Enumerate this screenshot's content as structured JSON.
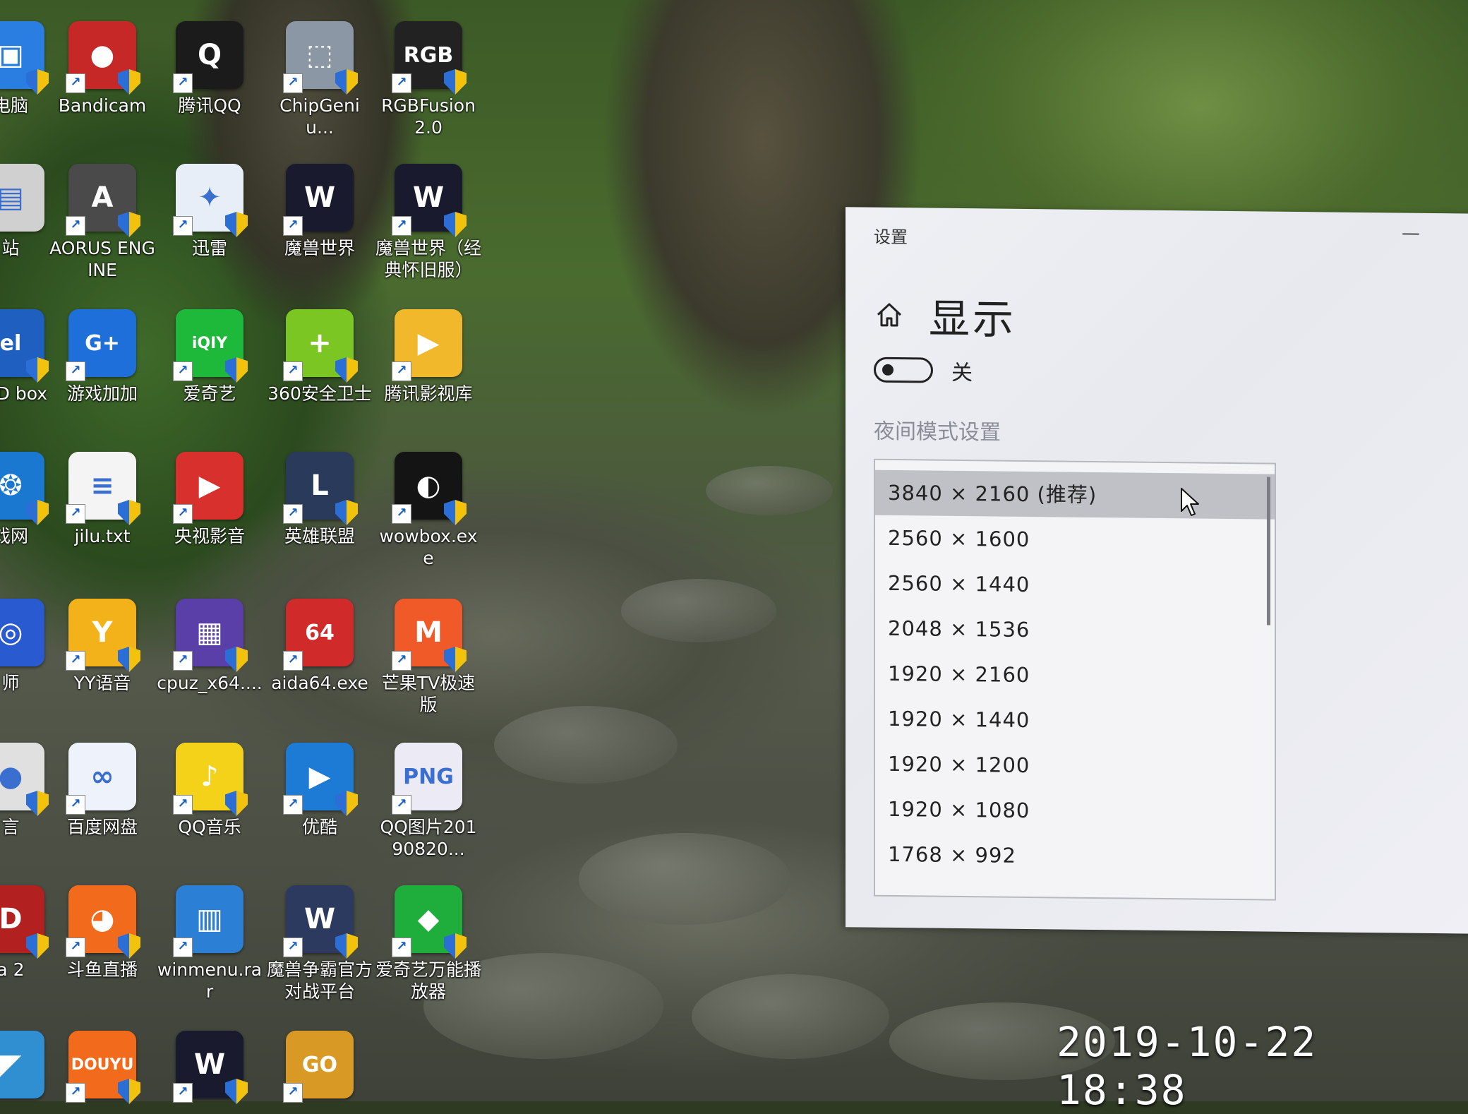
{
  "desktop": {
    "icons": [
      {
        "label": "电脑",
        "color": "#2a7de1",
        "glyph": "▣"
      },
      {
        "label": "Bandicam",
        "color": "#c62828",
        "glyph": "●"
      },
      {
        "label": "腾讯QQ",
        "color": "#1b1b1b",
        "glyph": "Q"
      },
      {
        "label": "ChipGeniu...",
        "color": "#8c97a6",
        "glyph": "⬚"
      },
      {
        "label": "RGBFusion 2.0",
        "color": "#222222",
        "glyph": "RGB"
      },
      {
        "label": "站",
        "color": "#d0d0d0",
        "glyph": "▤"
      },
      {
        "label": "AORUS ENGINE",
        "color": "#4a4a4a",
        "glyph": "A"
      },
      {
        "label": "迅雷",
        "color": "#e8eef8",
        "glyph": "✦"
      },
      {
        "label": "魔兽世界",
        "color": "#1a1a2e",
        "glyph": "W"
      },
      {
        "label": "魔兽世界（经典怀旧服）",
        "color": "#1a1a2e",
        "glyph": "W"
      },
      {
        "label": "SSD box",
        "color": "#1f5fbf",
        "glyph": "el"
      },
      {
        "label": "游戏加加",
        "color": "#1e6fd9",
        "glyph": "G+"
      },
      {
        "label": "爱奇艺",
        "color": "#1eb93a",
        "glyph": "iQIY"
      },
      {
        "label": "360安全卫士",
        "color": "#7cc623",
        "glyph": "+"
      },
      {
        "label": "腾讯影视库",
        "color": "#f2b82b",
        "glyph": "▶"
      },
      {
        "label": "戏网",
        "color": "#1b78d0",
        "glyph": "❂"
      },
      {
        "label": "jilu.txt",
        "color": "#f4f4f4",
        "glyph": "≡"
      },
      {
        "label": "央视影音",
        "color": "#d8312d",
        "glyph": "▶"
      },
      {
        "label": "英雄联盟",
        "color": "#2a3a5a",
        "glyph": "L"
      },
      {
        "label": "wowbox.exe",
        "color": "#141414",
        "glyph": "◐"
      },
      {
        "label": "师",
        "color": "#2a5ad0",
        "glyph": "◎"
      },
      {
        "label": "YY语音",
        "color": "#f4b21a",
        "glyph": "Y"
      },
      {
        "label": "cpuz_x64....",
        "color": "#5b3fa8",
        "glyph": "▦"
      },
      {
        "label": "aida64.exe",
        "color": "#d02a2a",
        "glyph": "64"
      },
      {
        "label": "芒果TV极速版",
        "color": "#f05a28",
        "glyph": "M"
      },
      {
        "label": "言",
        "color": "#e0e0e0",
        "glyph": "●"
      },
      {
        "label": "百度网盘",
        "color": "#eef3fb",
        "glyph": "∞"
      },
      {
        "label": "QQ音乐",
        "color": "#f4d21a",
        "glyph": "♪"
      },
      {
        "label": "优酷",
        "color": "#1d7bd6",
        "glyph": "▶"
      },
      {
        "label": "QQ图片20190820...",
        "color": "#eceaf4",
        "glyph": "PNG"
      },
      {
        "label": "a 2",
        "color": "#b32020",
        "glyph": "D"
      },
      {
        "label": "斗鱼直播",
        "color": "#f26b1d",
        "glyph": "◕"
      },
      {
        "label": "winmenu.rar",
        "color": "#2b7fd4",
        "glyph": "▥"
      },
      {
        "label": "魔兽争霸官方对战平台",
        "color": "#2d3a60",
        "glyph": "W"
      },
      {
        "label": "爱奇艺万能播放器",
        "color": "#1fae3c",
        "glyph": "◆"
      },
      {
        "label": "",
        "color": "#2f8fd0",
        "glyph": "◤"
      },
      {
        "label": "",
        "color": "#f26b1d",
        "glyph": "DOUYU"
      },
      {
        "label": "",
        "color": "#1a1a2e",
        "glyph": "W"
      },
      {
        "label": "",
        "color": "#d89a24",
        "glyph": "GO"
      }
    ]
  },
  "settings": {
    "window_title": "设置",
    "minimize_glyph": "—",
    "page_title": "显示",
    "night_light_toggle": {
      "state_label": "关",
      "on": false
    },
    "night_light_settings_link": "夜间模式设置",
    "resolution_options": [
      "3840 × 2160 (推荐)",
      "2560 × 1600",
      "2560 × 1440",
      "2048 × 1536",
      "1920 × 2160",
      "1920 × 1440",
      "1920 × 1200",
      "1920 × 1080",
      "1768 × 992"
    ],
    "selected_index": 0
  },
  "overlay": {
    "timestamp": "2019-10-22  18:38"
  },
  "colors": {
    "window_bg": "#eceef3",
    "selected_bg": "#bfc1c7",
    "link_gray": "#8a8d96"
  }
}
